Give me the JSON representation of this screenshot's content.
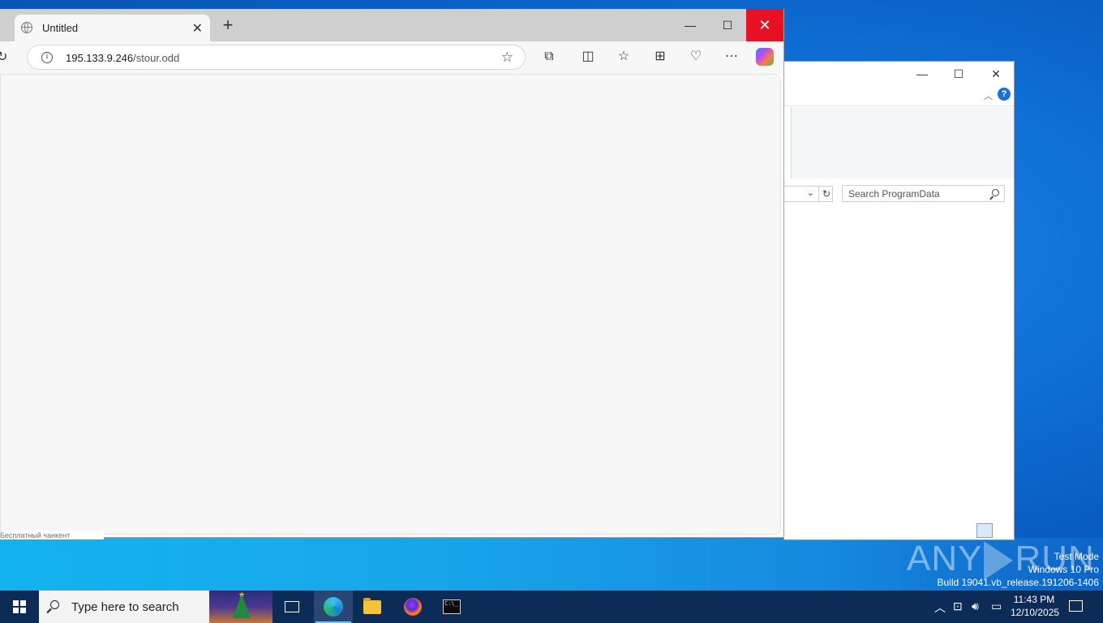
{
  "browser": {
    "tab_title": "Untitled",
    "url_host": "195.133.9.246",
    "url_path": "/stour.odd",
    "new_tab_symbol": "+",
    "close_symbol": "✕",
    "icons": [
      "globe-icon",
      "info-icon",
      "favorite-star-icon",
      "extensions-icon",
      "split-screen-icon",
      "favorites-icon",
      "collections-icon",
      "browser-essentials-icon",
      "more-icon",
      "copilot-icon"
    ]
  },
  "explorer": {
    "search_placeholder": "Search ProgramData",
    "help_label": "?"
  },
  "status_strip": "Бесплатный чанкент",
  "watermark": {
    "text_left": "ANY",
    "text_right": "RUN"
  },
  "system_info": {
    "line1": "Test Mode",
    "line2": "Windows 10 Pro",
    "line3": "Build 19041.vb_release.191206-1406"
  },
  "taskbar": {
    "search_placeholder": "Type here to search",
    "time": "11:43 PM",
    "date": "12/10/2025",
    "apps": [
      "task-view",
      "edge",
      "file-explorer",
      "firefox",
      "command-prompt"
    ]
  }
}
